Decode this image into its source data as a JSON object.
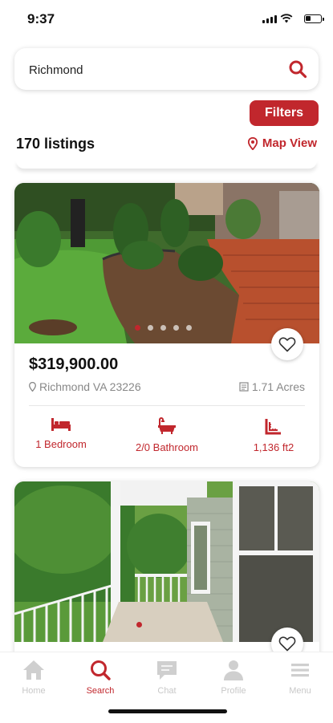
{
  "status_bar": {
    "time": "9:37"
  },
  "search": {
    "value": "Richmond"
  },
  "toolbar": {
    "filters_label": "Filters",
    "listing_count": "170 listings",
    "map_view_label": "Map View"
  },
  "listings": [
    {
      "price": "$319,900.00",
      "location": "Richmond VA 23226",
      "lot_size": "1.71 Acres",
      "bedrooms": "1 Bedroom",
      "bathrooms": "2/0 Bathroom",
      "area": "1,136 ft2",
      "photo_count": 5,
      "active_photo": 1
    },
    {
      "photo_count": 1,
      "active_photo": 1
    }
  ],
  "tab_bar": {
    "items": [
      {
        "label": "Home",
        "icon": "home-icon"
      },
      {
        "label": "Search",
        "icon": "search-icon",
        "active": true
      },
      {
        "label": "Chat",
        "icon": "chat-icon"
      },
      {
        "label": "Profile",
        "icon": "profile-icon"
      },
      {
        "label": "Menu",
        "icon": "menu-icon"
      }
    ]
  },
  "colors": {
    "accent": "#c1272d",
    "inactive_tab": "#c8c8c8",
    "muted_text": "#888888"
  }
}
